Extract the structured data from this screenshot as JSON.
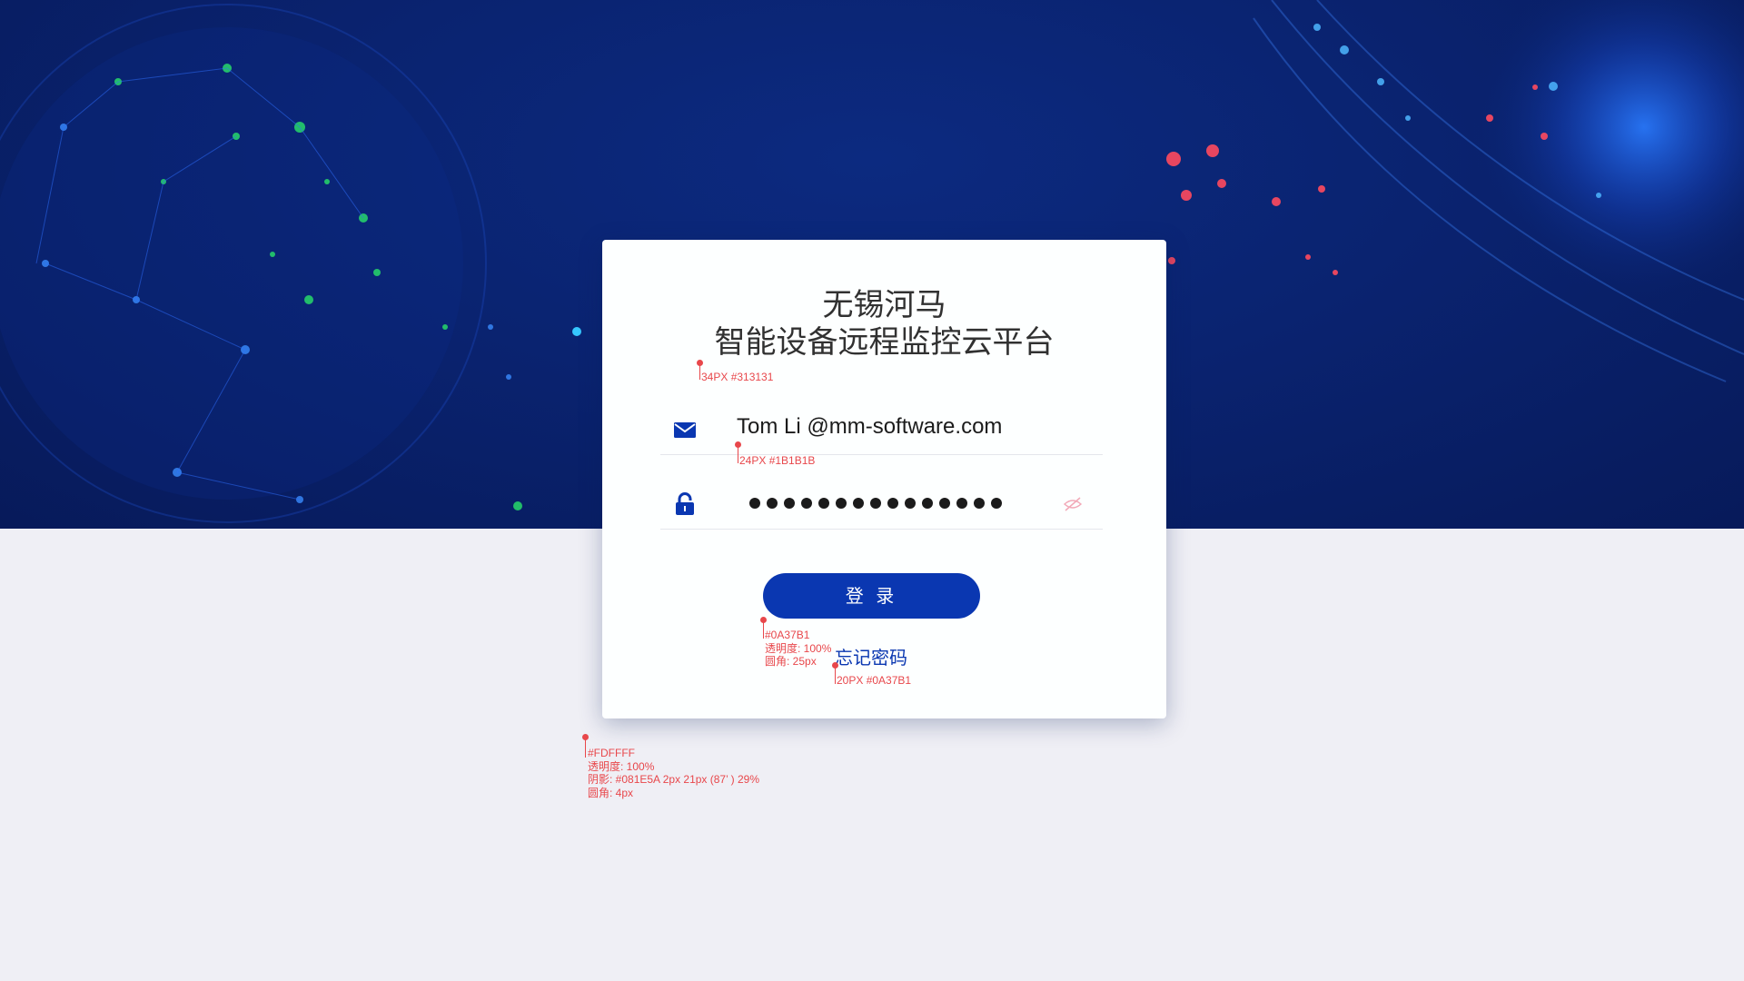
{
  "app": {
    "title_line1": "无锡河马",
    "title_line2": "智能设备远程监控云平台"
  },
  "login": {
    "email_value": "Tom Li @mm-software.com",
    "password_mask_count": 15,
    "submit_label": "登 录",
    "forgot_label": "忘记密码"
  },
  "colors": {
    "title": "#313131",
    "input_text": "#1B1B1B",
    "accent": "#0A37B1",
    "card_bg": "#FDFFFF",
    "annotation": "#E8474B"
  },
  "icons": {
    "email": "mail-icon",
    "password": "lock-icon",
    "visibility": "eye-off-icon"
  },
  "annotations": {
    "title_spec": "34PX #313131",
    "input_spec": "24PX #1B1B1B",
    "button_spec_1": "#0A37B1",
    "button_spec_2": "透明度: 100%",
    "button_spec_3": "圆角: 25px",
    "forgot_spec": "20PX #0A37B1",
    "card_spec_1": "#FDFFFF",
    "card_spec_2": "透明度: 100%",
    "card_spec_3": "阴影: #081E5A 2px 21px (87’ ) 29%",
    "card_spec_4": "圆角: 4px"
  }
}
